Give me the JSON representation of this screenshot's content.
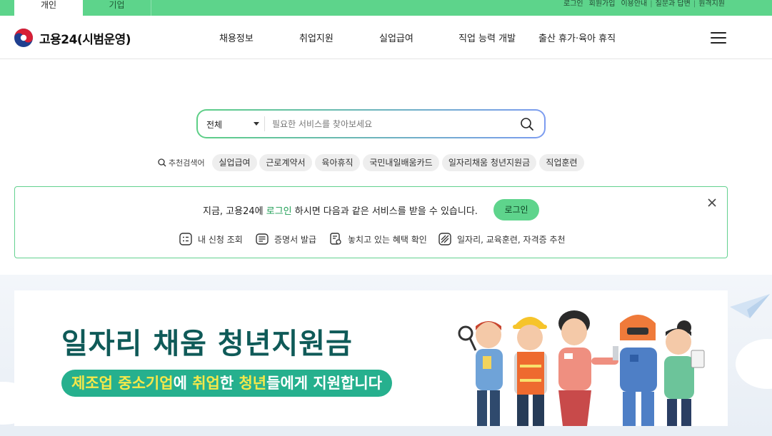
{
  "topbar": {
    "tabs": [
      {
        "label": "개인",
        "active": true
      },
      {
        "label": "기업",
        "active": false
      }
    ],
    "util_links": [
      "로그인",
      "회원가입",
      "이용안내",
      "질문과 답변",
      "원격지원"
    ]
  },
  "header": {
    "brand": "고용24(시범운영)",
    "nav": [
      "채용정보",
      "취업지원",
      "실업급여",
      "직업 능력 개발",
      "출산 휴가·육아 휴직"
    ],
    "menu_icon": "hamburger-icon"
  },
  "search": {
    "scope": "전체",
    "placeholder": "필요한 서비스를 찾아보세요",
    "value": ""
  },
  "keywords": {
    "label": "추천검색어",
    "items": [
      "실업급여",
      "근로계약서",
      "육아휴직",
      "국민내일배움카드",
      "일자리채움 청년지원금",
      "직업훈련"
    ]
  },
  "notice": {
    "text_before": "지금, 고용24에 ",
    "text_link": "로그인",
    "text_after": " 하시면 다음과 같은 서비스를 받을 수 있습니다.",
    "login_label": "로그인",
    "services": [
      {
        "label": "내 신청 조회",
        "icon": "list-check-icon"
      },
      {
        "label": "증명서 발급",
        "icon": "certificate-icon"
      },
      {
        "label": "놓치고 있는 혜택 확인",
        "icon": "document-search-icon"
      },
      {
        "label": "일자리, 교육훈련, 자격증 추천",
        "icon": "recommend-icon"
      }
    ]
  },
  "banner": {
    "title": "일자리 채움 청년지원금",
    "sub_part1": "제조업 중소기업",
    "sub_part2": "에 ",
    "sub_part3": "취업",
    "sub_part4": "한 ",
    "sub_part5": "청년",
    "sub_part6": "들에게 지원합니다"
  },
  "colors": {
    "brand_green": "#5dd48b",
    "banner_teal": "#0f5a58",
    "pill_green": "#26b08e",
    "highlight_yellow": "#f5e84a"
  }
}
